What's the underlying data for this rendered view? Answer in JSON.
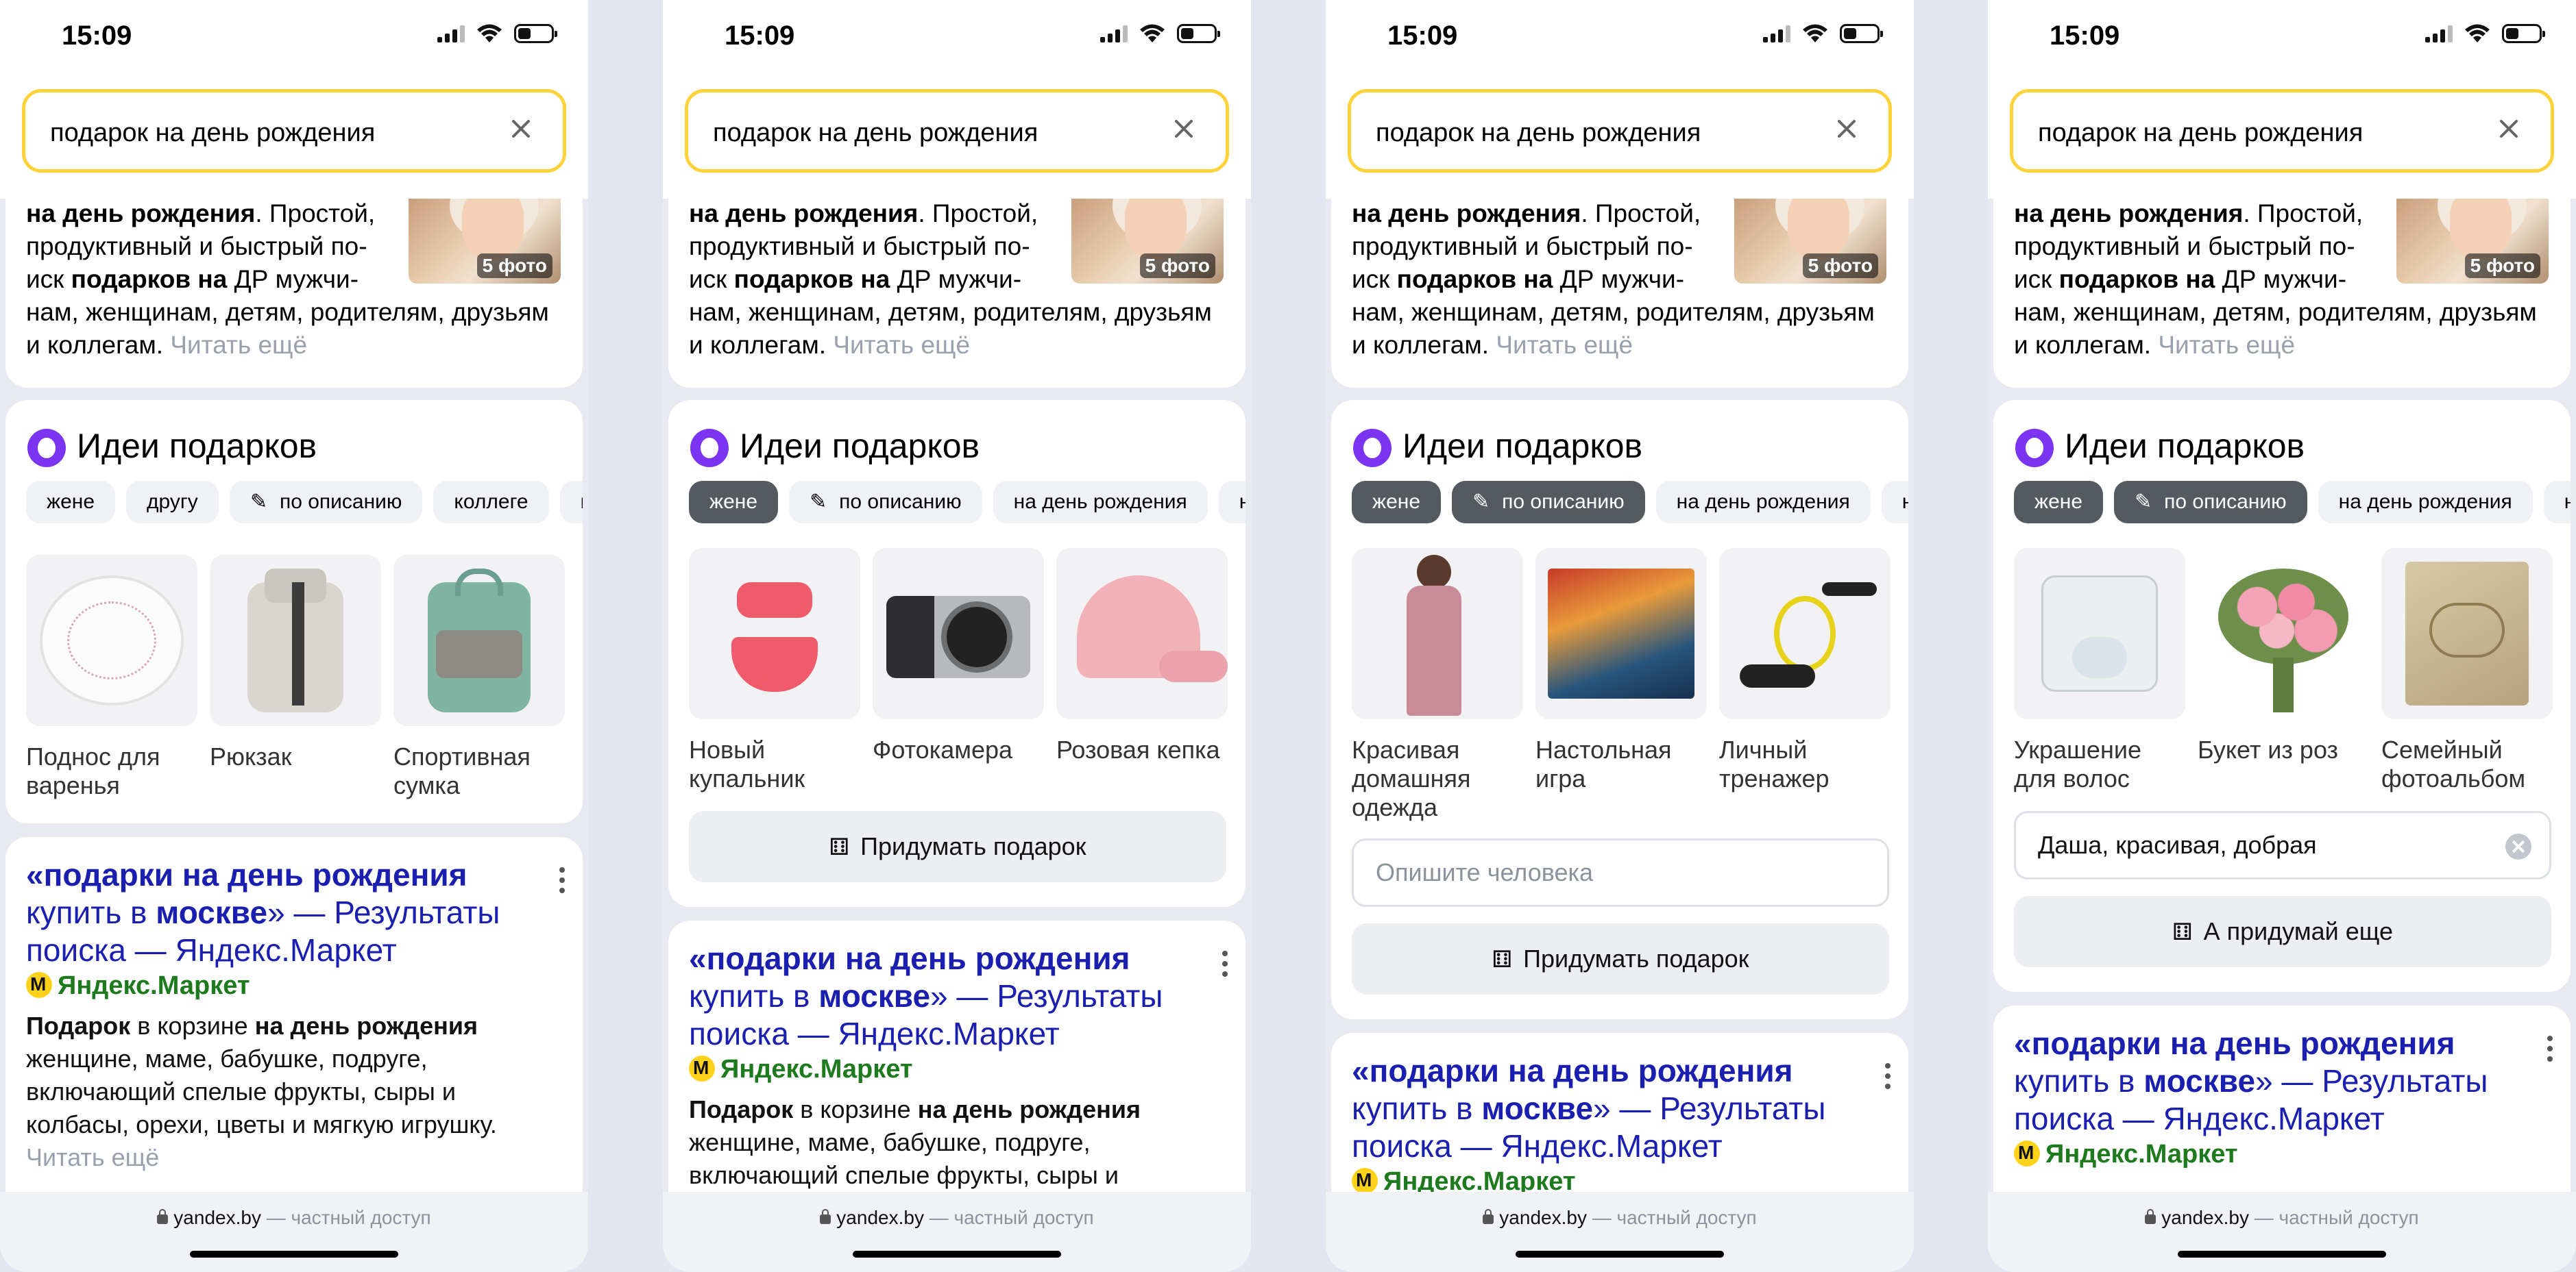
{
  "status": {
    "time": "15:09"
  },
  "search": {
    "query": "подарок на день рождения"
  },
  "snippet": {
    "line1_bold": "на день рождения",
    "line1_rest": ". Простой,",
    "line2": "продуктивный и быстрый по-",
    "line3_a": "иск ",
    "line3_bold": "подарков на",
    "line3_b": " ДР мужчи-",
    "line4": "нам, женщинам, детям, родителям, друзьям",
    "line5": "и коллегам.",
    "more": "Читать ещё",
    "photo_badge": "5 фото"
  },
  "ideas": {
    "title": "Идеи подарков",
    "action_button": "Придумать подарок",
    "again_button": "А придумай еще",
    "describe_placeholder": "Опишите человека",
    "describe_value": "Даша, красивая, добрая",
    "screens": [
      {
        "chips": [
          "жене",
          "другу",
          "по описанию",
          "коллеге",
          "подру"
        ],
        "products": [
          "Поднос для варенья",
          "Рюкзак",
          "Спортивная сумка"
        ]
      },
      {
        "chips": [
          "жене",
          "по описанию",
          "на день рождения",
          "на юб"
        ],
        "products": [
          "Новый купальник",
          "Фотокамера",
          "Розовая кепка"
        ]
      },
      {
        "chips": [
          "жене",
          "по описанию",
          "на день рождения",
          "на н"
        ],
        "products": [
          "Красивая домашняя одежда",
          "Настольная игра",
          "Личный тренажер"
        ]
      },
      {
        "chips": [
          "жене",
          "по описанию",
          "на день рождения",
          "на н"
        ],
        "products": [
          "Украшение для волос",
          "Букет из роз",
          "Семейный фотоальбом"
        ]
      }
    ]
  },
  "result": {
    "title_a": "«подарки на день рождения",
    "title_b": "купить в ",
    "title_bold": "москве",
    "title_c": "» — Результаты",
    "title_d": "поиска — Яндекс.Маркет",
    "site": "Яндекс.Маркет",
    "desc_bold1": "Подарок",
    "desc_a": " в корзине ",
    "desc_bold2": "на день рождения",
    "desc_line2": "женщине, маме, бабушке, подруге,",
    "desc_line3": "включающий спелые фрукты, сыры и",
    "desc_line4": "колбасы, орехи, цветы и мягкую игрушку.",
    "more": "Читать ещё"
  },
  "footer": {
    "domain": "yandex.by",
    "access": " — частный доступ"
  },
  "colors": {
    "search_border": "#fdd23b",
    "alice": "#7b35f2",
    "result_title": "#1b1faf",
    "site_green": "#1d7a1d",
    "active_chip": "#555960"
  }
}
